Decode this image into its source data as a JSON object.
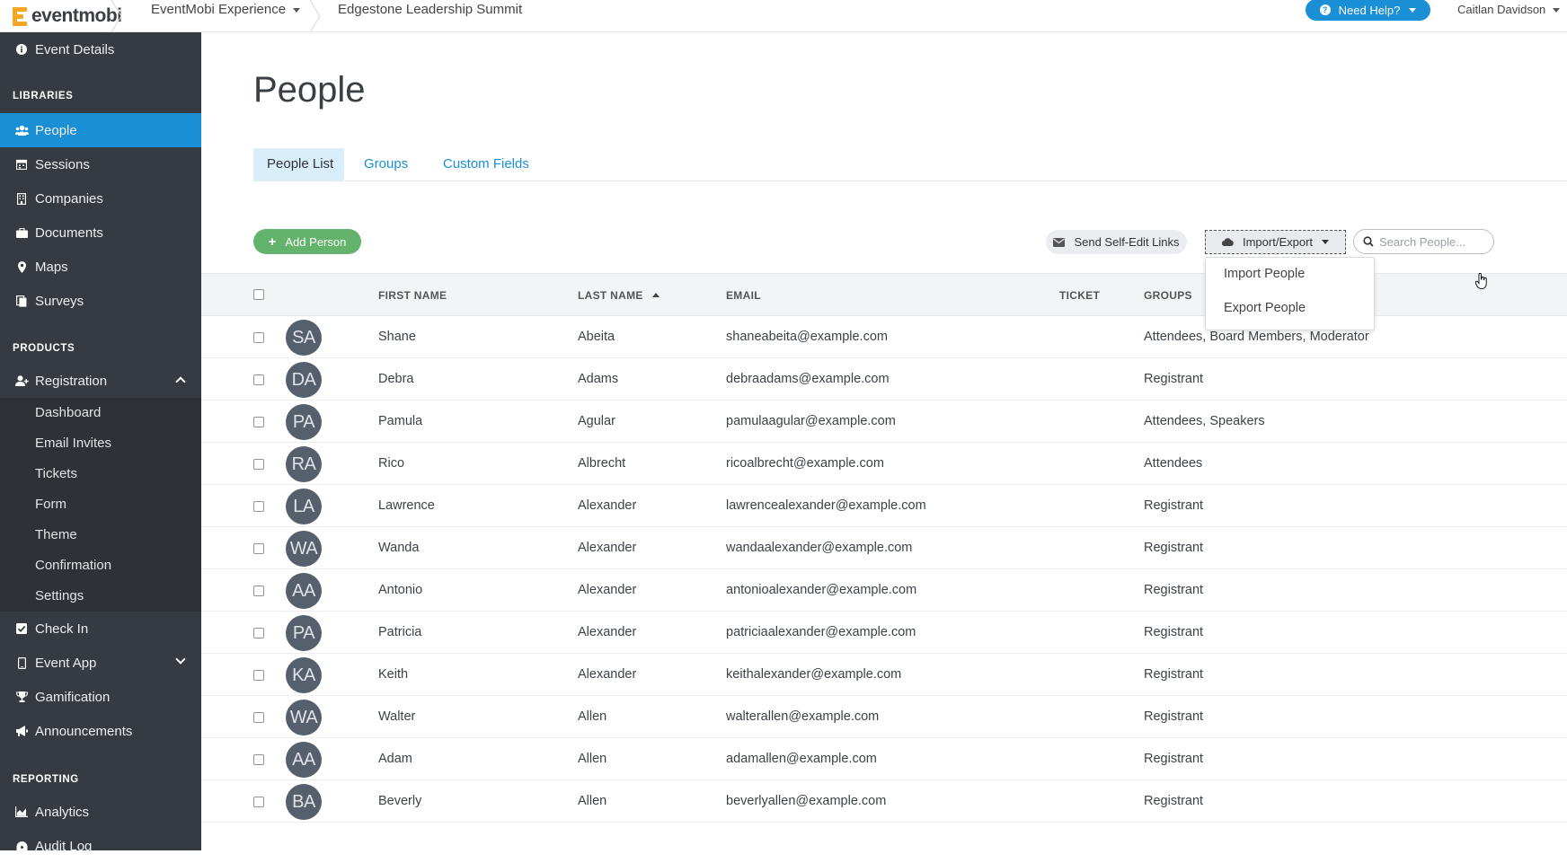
{
  "topbar": {
    "logo_text": "eventmobi",
    "product": "EventMobi Experience",
    "event": "Edgestone Leadership Summit",
    "help_label": "Need Help?",
    "user": "Caitlan Davidson"
  },
  "sidebar": {
    "event_details": "Event Details",
    "sections": {
      "libraries": "LIBRARIES",
      "products": "PRODUCTS",
      "reporting": "REPORTING"
    },
    "libraries": [
      "People",
      "Sessions",
      "Companies",
      "Documents",
      "Maps",
      "Surveys"
    ],
    "registration": "Registration",
    "registration_sub": [
      "Dashboard",
      "Email Invites",
      "Tickets",
      "Form",
      "Theme",
      "Confirmation",
      "Settings"
    ],
    "products": [
      "Check In",
      "Event App",
      "Gamification",
      "Announcements"
    ],
    "reporting": [
      "Analytics",
      "Audit Log"
    ],
    "active_color": "#1a8fd6"
  },
  "main": {
    "title": "People",
    "tabs": [
      "People List",
      "Groups",
      "Custom Fields"
    ],
    "add_person": "Add Person",
    "send_links": "Send Self-Edit Links",
    "import_export": "Import/Export",
    "search_placeholder": "Search People...",
    "dropdown": [
      "Import People",
      "Export People"
    ],
    "columns": {
      "first": "FIRST NAME",
      "last": "LAST NAME",
      "email": "EMAIL",
      "ticket": "TICKET",
      "groups": "GROUPS"
    },
    "rows": [
      {
        "initials": "SA",
        "first": "Shane",
        "last": "Abeita",
        "email": "shaneabeita@example.com",
        "groups": "Attendees, Board Members, Moderator"
      },
      {
        "initials": "DA",
        "first": "Debra",
        "last": "Adams",
        "email": "debraadams@example.com",
        "groups": "Registrant"
      },
      {
        "initials": "PA",
        "first": "Pamula",
        "last": "Agular",
        "email": "pamulaagular@example.com",
        "groups": "Attendees, Speakers"
      },
      {
        "initials": "RA",
        "first": "Rico",
        "last": "Albrecht",
        "email": "ricoalbrecht@example.com",
        "groups": "Attendees"
      },
      {
        "initials": "LA",
        "first": "Lawrence",
        "last": "Alexander",
        "email": "lawrencealexander@example.com",
        "groups": "Registrant"
      },
      {
        "initials": "WA",
        "first": "Wanda",
        "last": "Alexander",
        "email": "wandaalexander@example.com",
        "groups": "Registrant"
      },
      {
        "initials": "AA",
        "first": "Antonio",
        "last": "Alexander",
        "email": "antonioalexander@example.com",
        "groups": "Registrant"
      },
      {
        "initials": "PA",
        "first": "Patricia",
        "last": "Alexander",
        "email": "patriciaalexander@example.com",
        "groups": "Registrant"
      },
      {
        "initials": "KA",
        "first": "Keith",
        "last": "Alexander",
        "email": "keithalexander@example.com",
        "groups": "Registrant"
      },
      {
        "initials": "WA",
        "first": "Walter",
        "last": "Allen",
        "email": "walterallen@example.com",
        "groups": "Registrant"
      },
      {
        "initials": "AA",
        "first": "Adam",
        "last": "Allen",
        "email": "adamallen@example.com",
        "groups": "Registrant"
      },
      {
        "initials": "BA",
        "first": "Beverly",
        "last": "Allen",
        "email": "beverlyallen@example.com",
        "groups": "Registrant"
      }
    ]
  }
}
